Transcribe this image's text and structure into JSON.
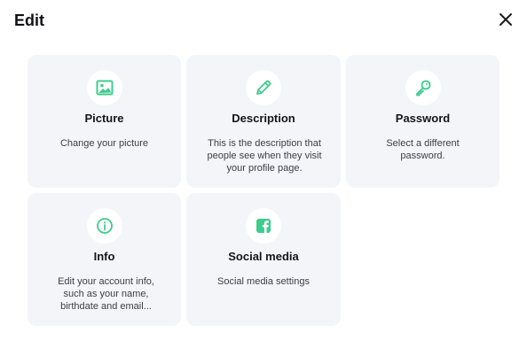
{
  "header": {
    "title": "Edit",
    "close_icon": "close-icon"
  },
  "accent_color": "#3dcc8e",
  "cards": [
    {
      "title": "Picture",
      "description": "Change your picture",
      "icon": "image-icon"
    },
    {
      "title": "Description",
      "description": "This is the description that people see when they visit your profile page.",
      "icon": "pencil-icon"
    },
    {
      "title": "Password",
      "description": "Select a different password.",
      "icon": "key-icon"
    },
    {
      "title": "Info",
      "description": "Edit your account info, such as your name, birthdate and email...",
      "icon": "info-icon"
    },
    {
      "title": "Social media",
      "description": "Social media settings",
      "icon": "facebook-icon"
    }
  ]
}
